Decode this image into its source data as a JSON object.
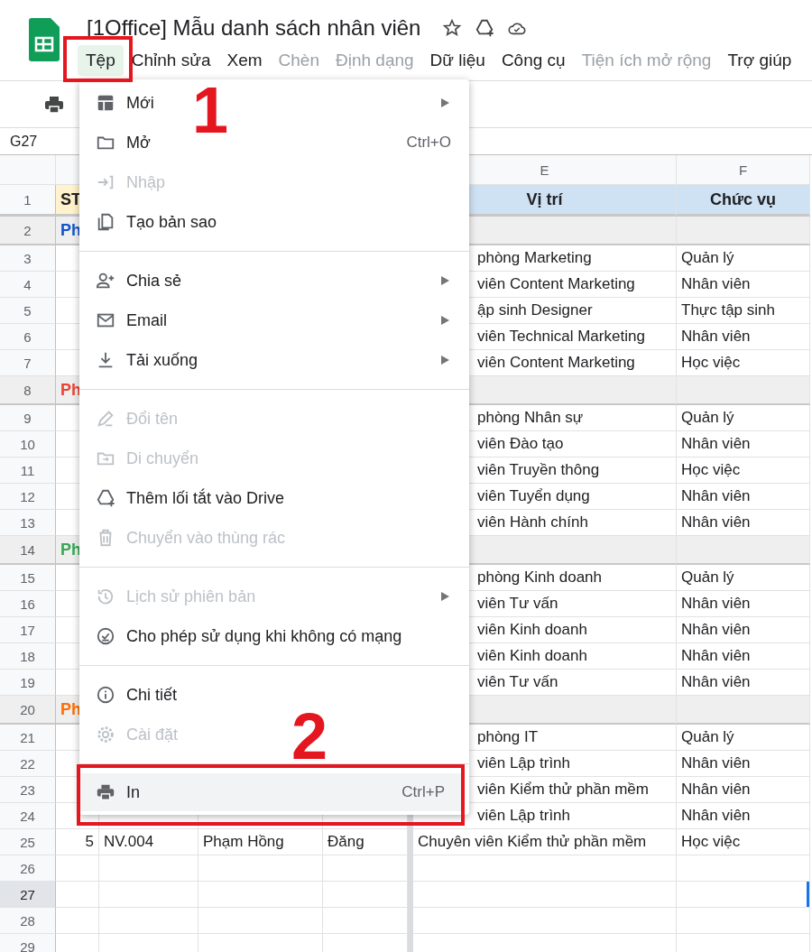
{
  "window": {
    "title": "[1Office] Mẫu danh sách nhân viên"
  },
  "menu_bar": [
    {
      "label": "Tệp",
      "selected": true,
      "disabled": false
    },
    {
      "label": "Chỉnh sửa",
      "selected": false,
      "disabled": false
    },
    {
      "label": "Xem",
      "selected": false,
      "disabled": false
    },
    {
      "label": "Chèn",
      "selected": false,
      "disabled": true
    },
    {
      "label": "Định dạng",
      "selected": false,
      "disabled": true
    },
    {
      "label": "Dữ liệu",
      "selected": false,
      "disabled": false
    },
    {
      "label": "Công cụ",
      "selected": false,
      "disabled": false
    },
    {
      "label": "Tiện ích mở rộng",
      "selected": false,
      "disabled": true
    },
    {
      "label": "Trợ giúp",
      "selected": false,
      "disabled": false
    }
  ],
  "name_box": "G27",
  "columns": [
    {
      "letter": "E"
    },
    {
      "letter": "F"
    }
  ],
  "rows": [
    {
      "number": "1",
      "kind": "header",
      "selected": false,
      "covered": false,
      "cells": {
        "A": "ST",
        "E": "Vị trí",
        "F": "Chức vụ"
      }
    },
    {
      "number": "2",
      "kind": "group",
      "selected": false,
      "covered": true,
      "color": "#1155cc",
      "cells": {
        "A": "Ph"
      }
    },
    {
      "number": "3",
      "kind": "data",
      "selected": false,
      "covered": true,
      "cells": {
        "E": "phòng Marketing",
        "F": "Quản lý"
      }
    },
    {
      "number": "4",
      "kind": "data",
      "selected": false,
      "covered": true,
      "cells": {
        "E": "viên Content Marketing",
        "F": "Nhân viên"
      }
    },
    {
      "number": "5",
      "kind": "data",
      "selected": false,
      "covered": true,
      "cells": {
        "E": "ập sinh Designer",
        "F": "Thực tập sinh"
      }
    },
    {
      "number": "6",
      "kind": "data",
      "selected": false,
      "covered": true,
      "cells": {
        "E": "viên Technical Marketing",
        "F": "Nhân viên"
      }
    },
    {
      "number": "7",
      "kind": "data",
      "selected": false,
      "covered": true,
      "cells": {
        "E": "viên Content Marketing",
        "F": "Học việc"
      }
    },
    {
      "number": "8",
      "kind": "group",
      "selected": false,
      "covered": true,
      "color": "#ea4335",
      "cells": {
        "A": "Ph"
      }
    },
    {
      "number": "9",
      "kind": "data",
      "selected": false,
      "covered": true,
      "cells": {
        "E": "phòng Nhân sự",
        "F": "Quản lý"
      }
    },
    {
      "number": "10",
      "kind": "data",
      "selected": false,
      "covered": true,
      "cells": {
        "E": "viên Đào tạo",
        "F": "Nhân viên"
      }
    },
    {
      "number": "11",
      "kind": "data",
      "selected": false,
      "covered": true,
      "cells": {
        "E": "viên Truyền thông",
        "F": "Học việc"
      }
    },
    {
      "number": "12",
      "kind": "data",
      "selected": false,
      "covered": true,
      "cells": {
        "E": "viên Tuyển dụng",
        "F": "Nhân viên"
      }
    },
    {
      "number": "13",
      "kind": "data",
      "selected": false,
      "covered": true,
      "cells": {
        "E": "viên Hành chính",
        "F": "Nhân viên"
      }
    },
    {
      "number": "14",
      "kind": "group",
      "selected": false,
      "covered": true,
      "color": "#34a853",
      "cells": {
        "A": "Ph"
      }
    },
    {
      "number": "15",
      "kind": "data",
      "selected": false,
      "covered": true,
      "cells": {
        "E": "phòng Kinh doanh",
        "F": "Quản lý"
      }
    },
    {
      "number": "16",
      "kind": "data",
      "selected": false,
      "covered": true,
      "cells": {
        "E": "viên Tư vấn",
        "F": "Nhân viên"
      }
    },
    {
      "number": "17",
      "kind": "data",
      "selected": false,
      "covered": true,
      "cells": {
        "E": "viên Kinh doanh",
        "F": "Nhân viên"
      }
    },
    {
      "number": "18",
      "kind": "data",
      "selected": false,
      "covered": true,
      "cells": {
        "E": "viên Kinh doanh",
        "F": "Nhân viên"
      }
    },
    {
      "number": "19",
      "kind": "data",
      "selected": false,
      "covered": true,
      "cells": {
        "E": "viên Tư vấn",
        "F": "Nhân viên"
      }
    },
    {
      "number": "20",
      "kind": "group",
      "selected": false,
      "covered": true,
      "color": "#ff6d01",
      "cells": {
        "A": "Ph"
      }
    },
    {
      "number": "21",
      "kind": "data",
      "selected": false,
      "covered": true,
      "cells": {
        "E": "phòng IT",
        "F": "Quản lý"
      }
    },
    {
      "number": "22",
      "kind": "data",
      "selected": false,
      "covered": true,
      "cells": {
        "E": "viên Lập trình",
        "F": "Nhân viên"
      }
    },
    {
      "number": "23",
      "kind": "data",
      "selected": false,
      "covered": true,
      "cells": {
        "E": "viên Kiểm thử phần mềm",
        "F": "Nhân viên"
      }
    },
    {
      "number": "24",
      "kind": "data",
      "selected": false,
      "covered": true,
      "cells": {
        "E": "viên Lập trình",
        "F": "Nhân viên"
      }
    },
    {
      "number": "25",
      "kind": "data",
      "selected": false,
      "covered": false,
      "cells": {
        "A": "5",
        "B": "NV.004",
        "C": "Phạm Hồng",
        "D": "Đăng",
        "E": "Chuyên viên Kiểm thử phần mềm",
        "F": "Học việc"
      }
    },
    {
      "number": "26",
      "kind": "data",
      "selected": false,
      "covered": false,
      "cells": {}
    },
    {
      "number": "27",
      "kind": "data",
      "selected": true,
      "covered": false,
      "cells": {}
    },
    {
      "number": "28",
      "kind": "data",
      "selected": false,
      "covered": false,
      "cells": {}
    },
    {
      "number": "29",
      "kind": "data",
      "selected": false,
      "covered": false,
      "cells": {}
    }
  ],
  "file_menu": {
    "sections": [
      [
        {
          "label": "Mới",
          "disabled": false,
          "submenu": true,
          "selected": false
        },
        {
          "label": "Mở",
          "shortcut": "Ctrl+O",
          "disabled": false,
          "submenu": false,
          "selected": false
        },
        {
          "label": "Nhập",
          "disabled": true,
          "submenu": false,
          "selected": false
        },
        {
          "label": "Tạo bản sao",
          "disabled": false,
          "submenu": false,
          "selected": false
        }
      ],
      [
        {
          "label": "Chia sẻ",
          "disabled": false,
          "submenu": true,
          "selected": false
        },
        {
          "label": "Email",
          "disabled": false,
          "submenu": true,
          "selected": false
        },
        {
          "label": "Tải xuống",
          "disabled": false,
          "submenu": true,
          "selected": false
        }
      ],
      [
        {
          "label": "Đổi tên",
          "disabled": true,
          "submenu": false,
          "selected": false
        },
        {
          "label": "Di chuyển",
          "disabled": true,
          "submenu": false,
          "selected": false
        },
        {
          "label": "Thêm lối tắt vào Drive",
          "disabled": false,
          "submenu": false,
          "selected": false
        },
        {
          "label": "Chuyển vào thùng rác",
          "disabled": true,
          "submenu": false,
          "selected": false
        }
      ],
      [
        {
          "label": "Lịch sử phiên bản",
          "disabled": true,
          "submenu": true,
          "selected": false
        },
        {
          "label": "Cho phép sử dụng khi không có mạng",
          "disabled": false,
          "submenu": false,
          "selected": false
        }
      ],
      [
        {
          "label": "Chi tiết",
          "disabled": false,
          "submenu": false,
          "selected": false
        },
        {
          "label": "Cài đặt",
          "disabled": true,
          "submenu": false,
          "selected": false
        }
      ],
      [
        {
          "label": "In",
          "shortcut": "Ctrl+P",
          "disabled": false,
          "submenu": false,
          "selected": true
        }
      ]
    ]
  },
  "annotations": [
    {
      "label": "1"
    },
    {
      "label": "2"
    }
  ]
}
